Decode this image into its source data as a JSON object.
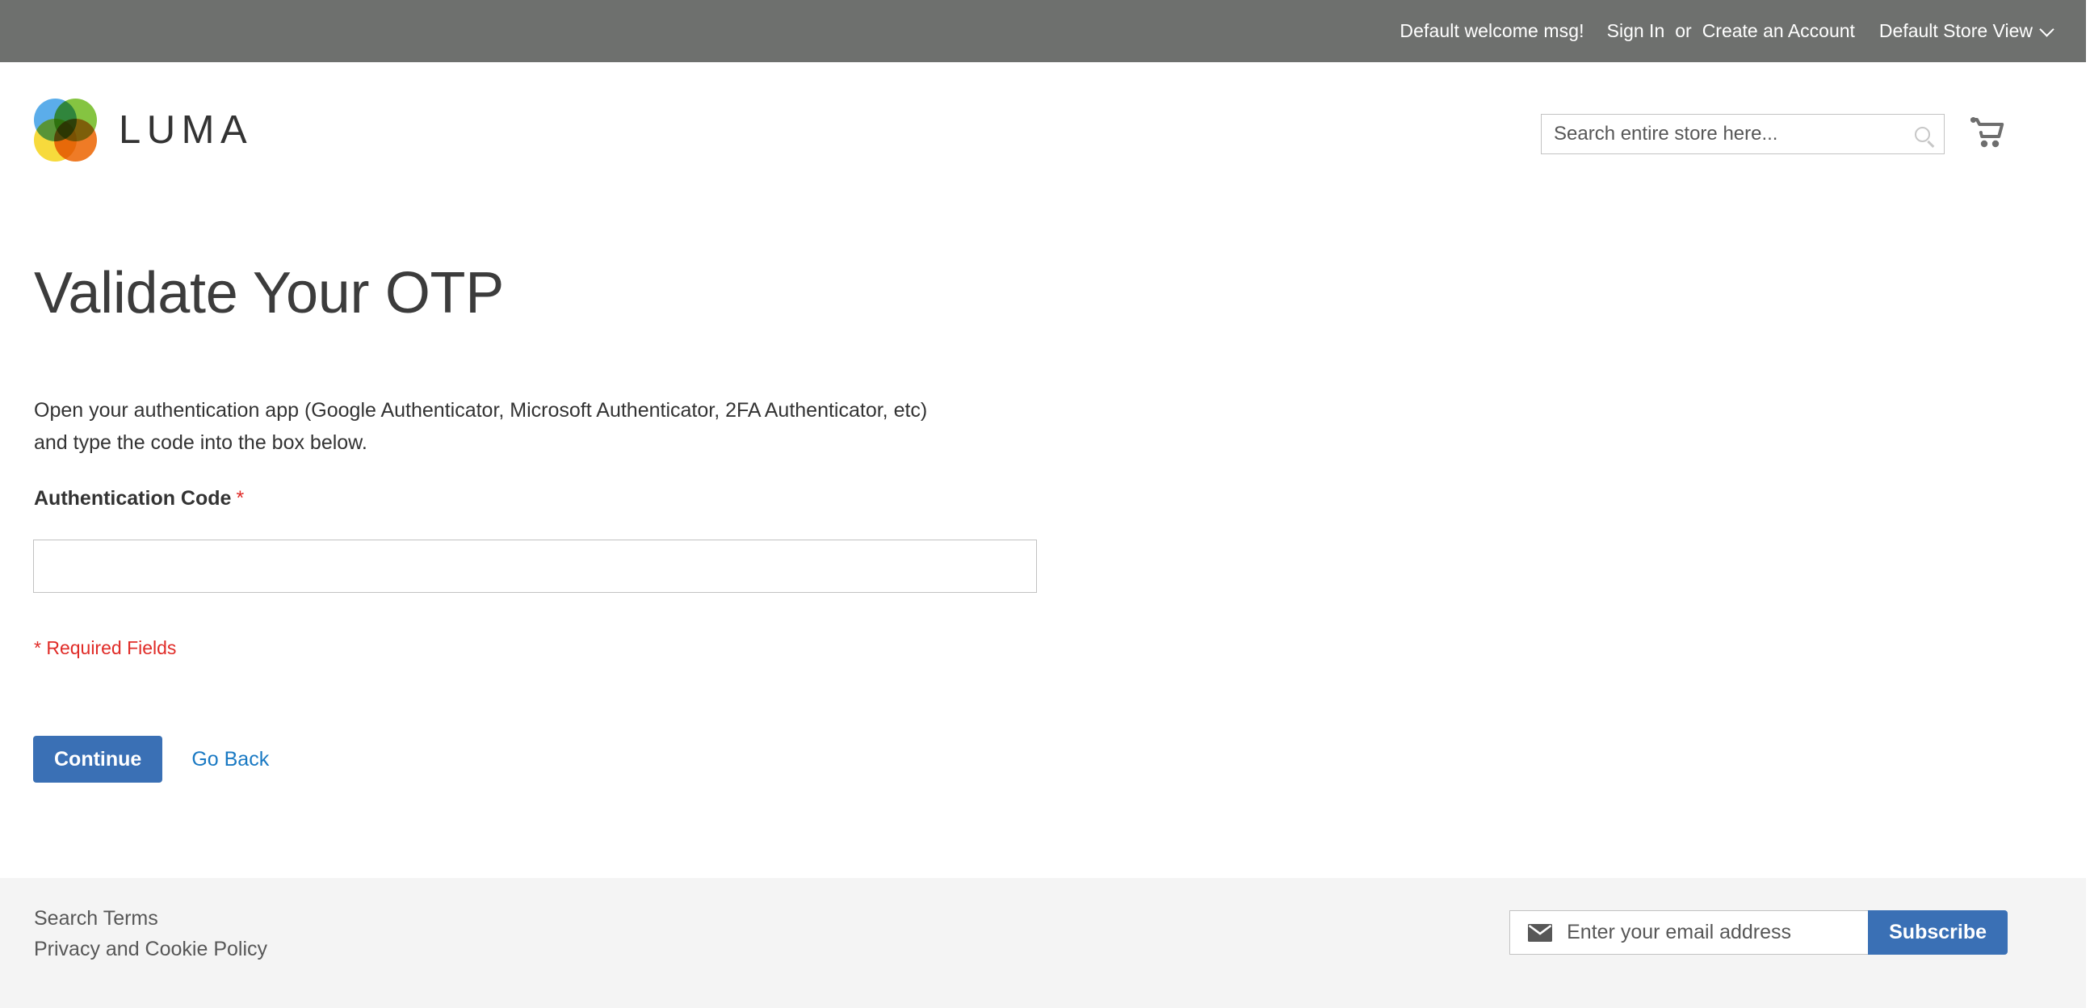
{
  "top_panel": {
    "welcome_message": "Default welcome msg!",
    "sign_in_label": "Sign In",
    "separator": "or",
    "create_account_label": "Create an Account",
    "store_view_label": "Default Store View",
    "chevron_icon": "chevron-down-icon"
  },
  "header": {
    "logo_text": "LUMA",
    "logo_icon": "luma-logo-icon",
    "search_placeholder": "Search entire store here...",
    "search_value": "",
    "search_icon": "search-icon",
    "cart_icon": "shopping-cart-icon"
  },
  "main": {
    "page_title": "Validate Your OTP",
    "intro_text": "Open your authentication app (Google Authenticator, Microsoft Authenticator, 2FA Authenticator, etc) and type the code into the box below.",
    "field_label": "Authentication Code",
    "required_marker": "*",
    "code_value": "",
    "code_placeholder": "",
    "required_fields_note": "* Required Fields",
    "continue_label": "Continue",
    "go_back_label": "Go Back"
  },
  "footer": {
    "links": [
      {
        "label": "Search Terms"
      },
      {
        "label": "Privacy and Cookie Policy"
      }
    ],
    "newsletter": {
      "envelope_icon": "envelope-icon",
      "email_placeholder": "Enter your email address",
      "email_value": "",
      "subscribe_label": "Subscribe"
    }
  },
  "colors": {
    "top_panel_bg": "#6e706e",
    "primary_button": "#3a70b5",
    "link_blue": "#1979c3",
    "required_red": "#e02b27",
    "footer_bg": "#f4f4f4",
    "border_gray": "#c2c2c2",
    "text_dark": "#333333"
  }
}
